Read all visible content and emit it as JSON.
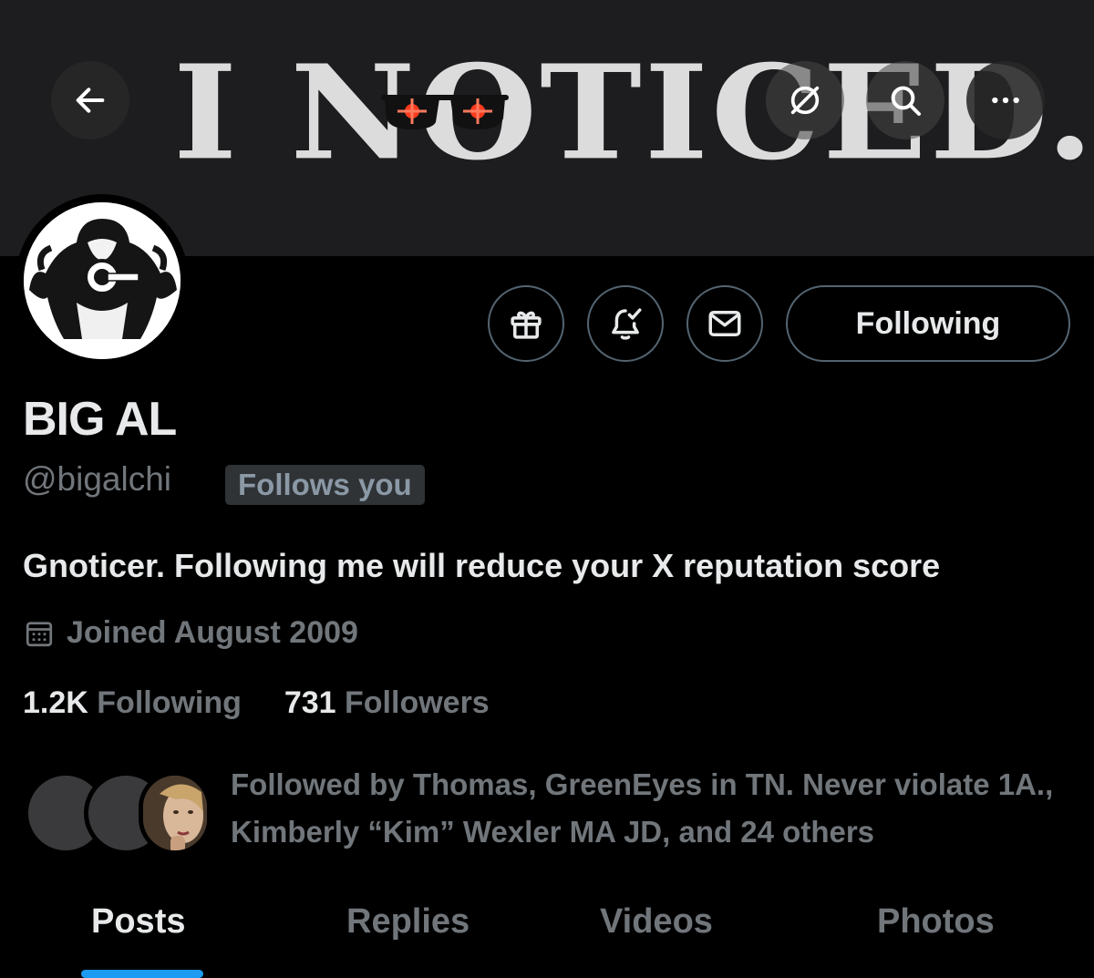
{
  "banner": {
    "text": "I NOTICED."
  },
  "header": {
    "back_icon": "arrow-left-icon",
    "grok_icon": "grok-icon",
    "search_icon": "search-icon",
    "more_icon": "more-dots-icon"
  },
  "profile": {
    "name": "BIG AL",
    "handle": "@bigalchi",
    "follows_you": "Follows you",
    "bio": "Gnoticer. Following me will reduce your X reputation score",
    "joined": "Joined August 2009",
    "following_count": "1.2K",
    "following_label": "Following",
    "followers_count": "731",
    "followers_label": "Followers",
    "followed_by": "Followed by Thomas, GreenEyes in TN. Never violate 1A., Kimberly “Kim” Wexler MA JD, and 24 others"
  },
  "actions": {
    "gift_icon": "gift-icon",
    "notify_icon": "bell-check-icon",
    "message_icon": "envelope-icon",
    "follow_label": "Following"
  },
  "tabs": [
    {
      "label": "Posts",
      "active": true
    },
    {
      "label": "Replies",
      "active": false
    },
    {
      "label": "Videos",
      "active": false
    },
    {
      "label": "Photos",
      "active": false
    }
  ],
  "colors": {
    "background": "#000000",
    "accent": "#1d9bf0",
    "muted_text": "#71767b",
    "primary_text": "#e7e9ea"
  }
}
